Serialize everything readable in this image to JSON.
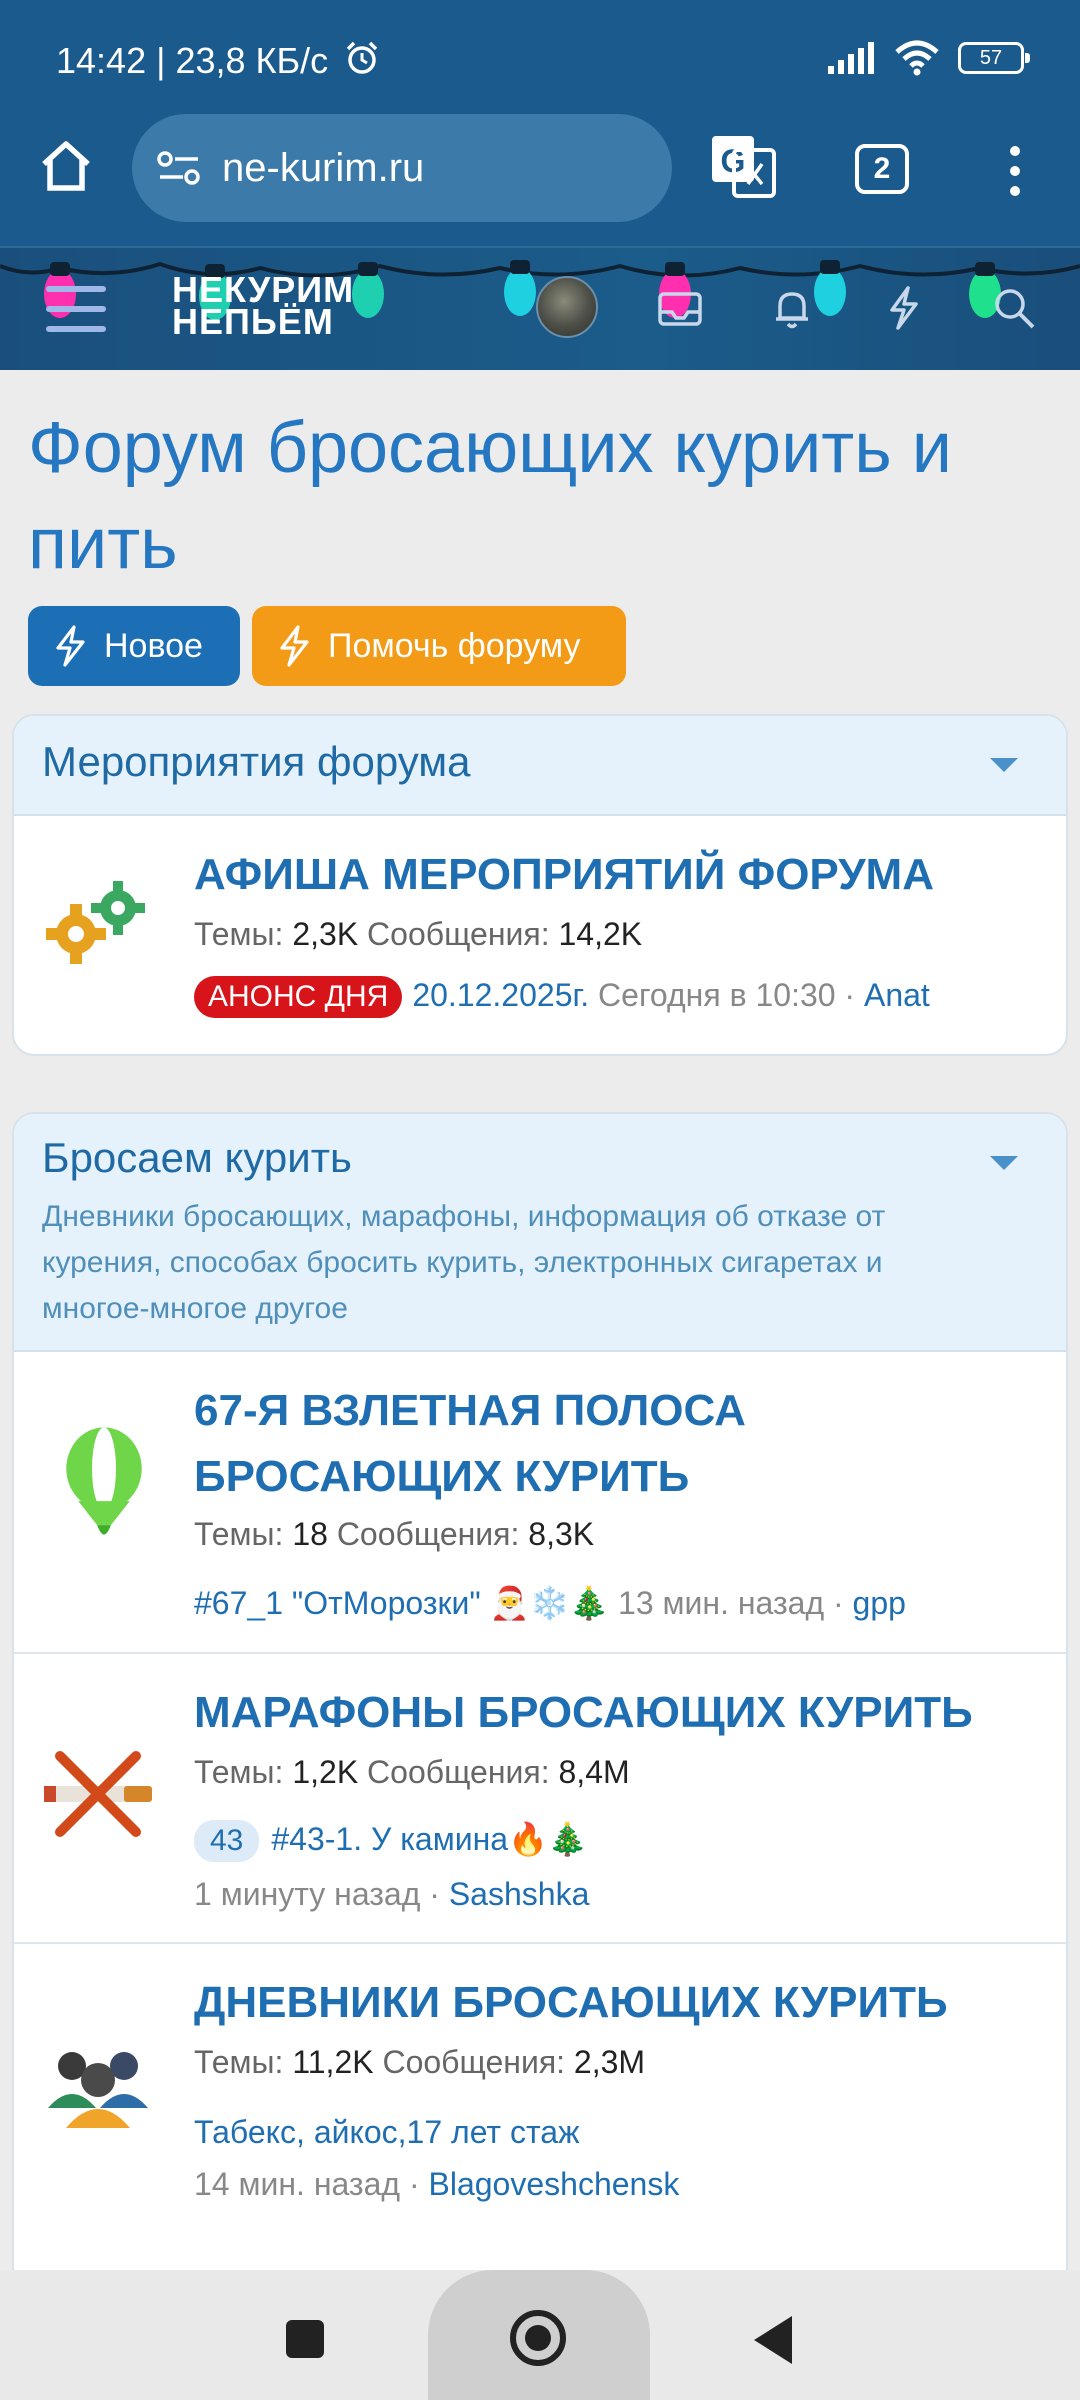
{
  "status_bar": {
    "time": "14:42 | 23,8 КБ/с",
    "battery": "57",
    "icons": [
      "alarm-icon",
      "signal-icon",
      "wifi-icon",
      "battery-icon"
    ]
  },
  "browser": {
    "url": "ne-kurim.ru",
    "tab_count": "2",
    "icons": [
      "home-icon",
      "site-settings-icon",
      "translate-icon",
      "tabs-icon",
      "menu-icon"
    ]
  },
  "site_header": {
    "logo_line1": "НЕКУРИМ",
    "logo_line2": "НЕПЬЁМ",
    "icons": [
      "menu-icon",
      "avatar",
      "inbox-icon",
      "bell-icon",
      "lightning-icon",
      "search-icon"
    ]
  },
  "page": {
    "title": "Форум бросающих курить и пить",
    "btn_new": "Новое",
    "btn_help": "Помочь форуму"
  },
  "colors": {
    "chrome": "#1b5a8c",
    "accent": "#2577c1",
    "help_button": "#f39a16",
    "badge_red": "#d7141a"
  },
  "sections": [
    {
      "title": "Мероприятия форума",
      "nodes": [
        {
          "title": "АФИША МЕРОПРИЯТИЙ ФОРУМА",
          "threads_label": "Темы:",
          "threads": "2,3K",
          "messages_label": "Сообщения:",
          "messages": "14,2K",
          "badge": "АНОНС ДНЯ",
          "latest_thread": "20.12.2025г.",
          "latest_time": "Сегодня в 10:30 ·",
          "latest_user": "Anat",
          "icon": "gears-icon"
        }
      ]
    },
    {
      "title": "Бросаем курить",
      "description": "Дневники бросающих, марафоны, информация об отказе от курения, способах бросить курить, электронных сигаретах и многое-многое другое",
      "nodes": [
        {
          "title": "67-Я ВЗЛЕТНАЯ ПОЛОСА БРОСАЮЩИХ КУРИТЬ",
          "threads_label": "Темы:",
          "threads": "18",
          "messages_label": "Сообщения:",
          "messages": "8,3K",
          "latest_thread": "#67_1 \"ОтМорозки\" 🎅❄️🎄",
          "latest_time": "13 мин. назад ·",
          "latest_user": "gpp",
          "icon": "balloon-icon"
        },
        {
          "title": "МАРАФОНЫ БРОСАЮЩИХ КУРИТЬ",
          "threads_label": "Темы:",
          "threads": "1,2K",
          "messages_label": "Сообщения:",
          "messages": "8,4M",
          "badge_num": "43",
          "latest_thread": "#43-1. У камина🔥🎄",
          "latest_time": "1 минуту назад ·",
          "latest_user": "Sashshka",
          "icon": "no-smoking-icon"
        },
        {
          "title": "ДНЕВНИКИ БРОСАЮЩИХ КУРИТЬ",
          "threads_label": "Темы:",
          "threads": "11,2K",
          "messages_label": "Сообщения:",
          "messages": "2,3M",
          "latest_thread": "Табекс, айкос,17 лет стаж",
          "latest_time": "14 мин. назад ·",
          "latest_user": "Blagoveshchensk",
          "icon": "users-icon"
        }
      ]
    }
  ],
  "navbar": {
    "icons": [
      "recents-icon",
      "home-icon",
      "back-icon"
    ]
  }
}
